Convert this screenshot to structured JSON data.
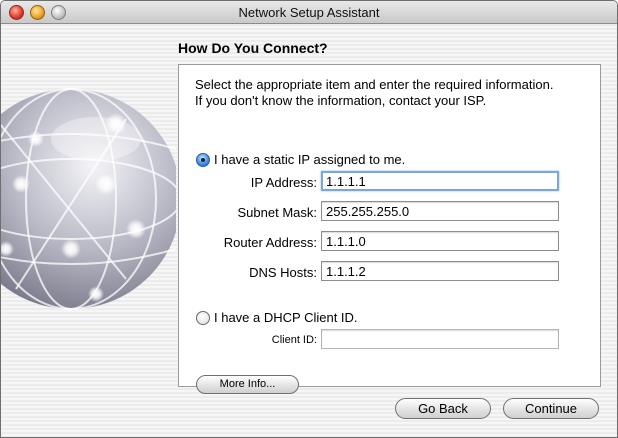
{
  "window": {
    "title": "Network Setup Assistant"
  },
  "page": {
    "heading": "How Do You Connect?",
    "instructions_line1": "Select the appropriate item and enter the required information.",
    "instructions_line2": "If you don't know the information, contact your ISP."
  },
  "static_option": {
    "label": "I have a static IP assigned to me.",
    "selected": true,
    "fields": {
      "ip_label": "IP Address:",
      "ip_value": "1.1.1.1",
      "subnet_label": "Subnet Mask:",
      "subnet_value": "255.255.255.0",
      "router_label": "Router Address:",
      "router_value": "1.1.1.0",
      "dns_label": "DNS Hosts:",
      "dns_value": "1.1.1.2"
    }
  },
  "dhcp_option": {
    "label": "I have a DHCP Client ID.",
    "selected": false,
    "client_id_label": "Client ID:",
    "client_id_value": ""
  },
  "buttons": {
    "more_info": "More Info...",
    "go_back": "Go Back",
    "continue": "Continue"
  },
  "icons": {
    "close": "close-button",
    "minimize": "minimize-button",
    "zoom": "zoom-button",
    "globe": "network-globe-icon"
  },
  "colors": {
    "focus_ring": "#7aa6d9",
    "radio_selected": "#3c8ae0"
  }
}
